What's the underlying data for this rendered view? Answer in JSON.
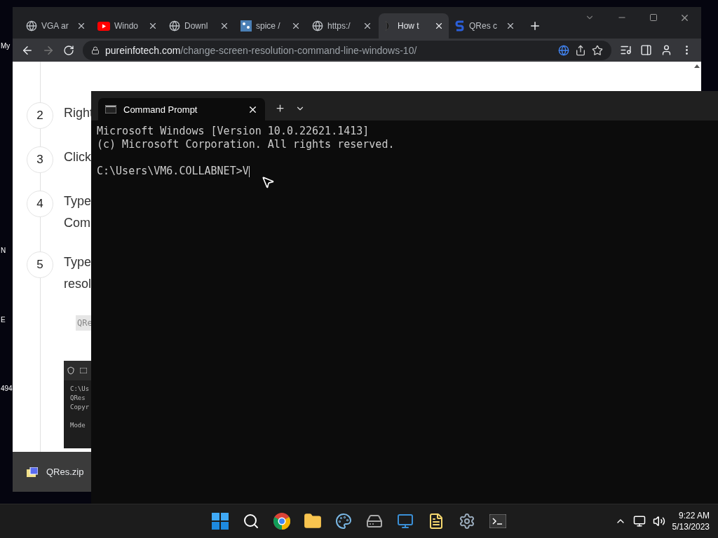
{
  "desktop_icons": [
    {
      "label": "My"
    },
    {
      "label": "N"
    },
    {
      "label": "E"
    },
    {
      "label": "494"
    }
  ],
  "browser": {
    "tabs": [
      {
        "title": "VGA ar",
        "kind": "globe",
        "selected": false
      },
      {
        "title": "Windo",
        "kind": "youtube",
        "selected": false
      },
      {
        "title": "Downl",
        "kind": "globe",
        "selected": false
      },
      {
        "title": "spice /",
        "kind": "spice",
        "selected": false
      },
      {
        "title": "https:/",
        "kind": "globe",
        "selected": false
      },
      {
        "title": "How t",
        "kind": "dark",
        "selected": true
      },
      {
        "title": "QRes c",
        "kind": "s",
        "selected": false
      }
    ],
    "address": {
      "domain": "pureinfotech.com",
      "path": "/change-screen-resolution-command-line-windows-10/"
    },
    "steps": [
      {
        "number": "2",
        "lines": [
          "Right"
        ]
      },
      {
        "number": "3",
        "lines": [
          "Click"
        ]
      },
      {
        "number": "4",
        "lines": [
          "Type",
          "Com"
        ]
      },
      {
        "number": "5",
        "lines": [
          "Type",
          "resol"
        ]
      }
    ],
    "code": "QRe",
    "screenshot_lines": [
      "C:\\Us",
      "QRes",
      "Copyr"
    ],
    "screenshot_footer": "Mode",
    "download": "QRes.zip"
  },
  "terminal": {
    "tab_title": "Command Prompt",
    "lines": [
      "Microsoft Windows [Version 10.0.22621.1413]",
      "(c) Microsoft Corporation. All rights reserved."
    ],
    "prompt": "C:\\Users\\VM6.COLLABNET>",
    "input": "V"
  },
  "taskbar": {
    "apps": [
      {
        "kind": "start"
      },
      {
        "kind": "search"
      },
      {
        "kind": "chrome"
      },
      {
        "kind": "folder"
      },
      {
        "kind": "paint"
      },
      {
        "kind": "drive"
      },
      {
        "kind": "remote"
      },
      {
        "kind": "notepad"
      },
      {
        "kind": "settings"
      },
      {
        "kind": "terminal"
      }
    ],
    "time": "9:22 AM",
    "date": "5/13/2023"
  }
}
